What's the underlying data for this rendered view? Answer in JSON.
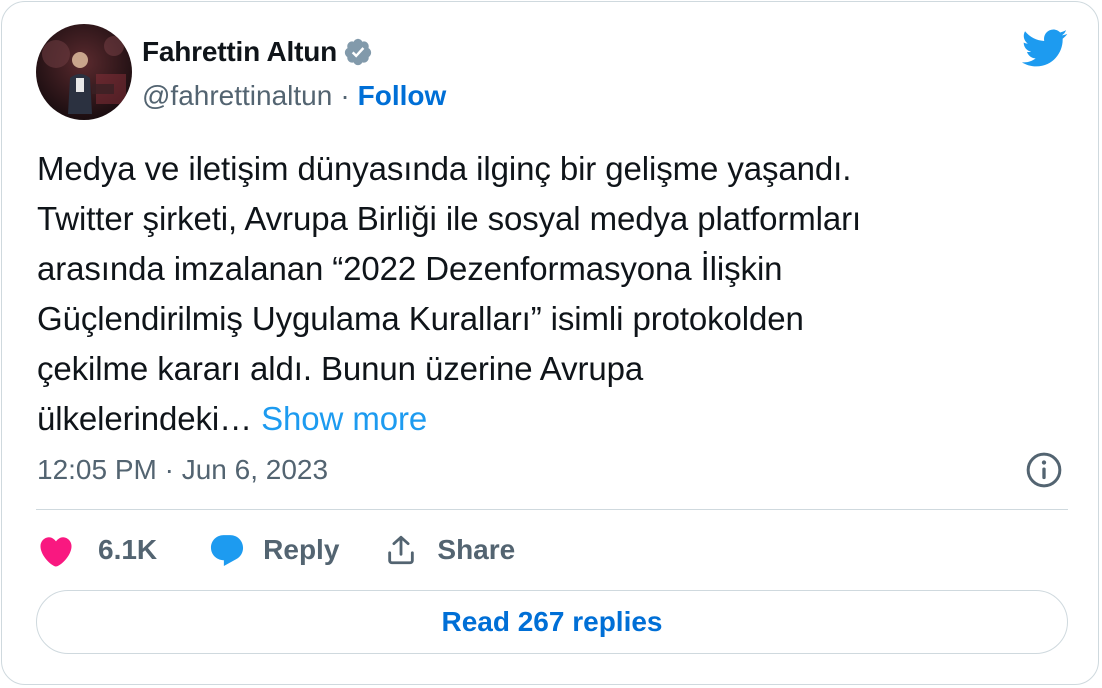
{
  "author": {
    "name": "Fahrettin Altun",
    "handle": "@fahrettinaltun",
    "separator": "·",
    "follow_label": "Follow",
    "verified_icon": "verified-badge-icon"
  },
  "tweet": {
    "lines": [
      "Medya ve iletişim dünyasında ilginç bir gelişme yaşandı.",
      "Twitter şirketi, Avrupa Birliği ile sosyal medya platformları",
      "arasında imzalanan “2022 Dezenformasyona İlişkin",
      "Güçlendirilmiş Uygulama Kuralları” isimli protokolden",
      "çekilme kararı aldı. Bunun üzerine Avrupa",
      "ülkelerindeki…"
    ],
    "show_more_label": "Show more",
    "timestamp": "12:05 PM · Jun 6, 2023"
  },
  "actions": {
    "like_count": "6.1K",
    "reply_label": "Reply",
    "share_label": "Share"
  },
  "footer": {
    "read_replies_label": "Read 267 replies"
  },
  "colors": {
    "accent": "#1d9bf0",
    "link": "#006fd6",
    "like": "#f91880",
    "muted": "#536471",
    "text": "#0f1419",
    "border": "#cfd9de"
  }
}
